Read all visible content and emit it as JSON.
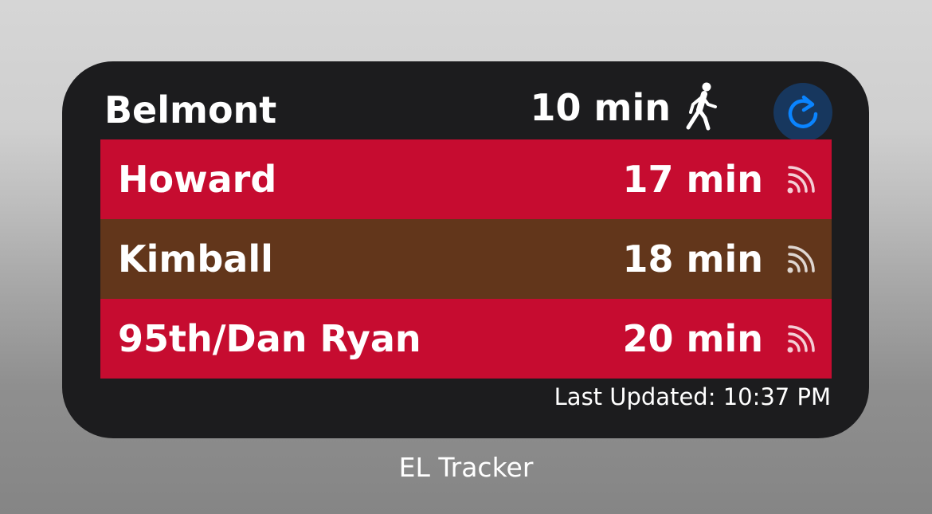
{
  "widget": {
    "station": "Belmont",
    "walk_time": "10 min",
    "walk_icon": "walking-person-icon",
    "refresh_icon": "refresh-icon",
    "refresh_color": "#0a84ff",
    "arrivals": [
      {
        "destination": "Howard",
        "eta": "17 min",
        "line_color": "#c60c30",
        "icon": "live-tracking-icon"
      },
      {
        "destination": "Kimball",
        "eta": "18 min",
        "line_color": "#62361b",
        "icon": "live-tracking-icon"
      },
      {
        "destination": "95th/Dan Ryan",
        "eta": "20 min",
        "line_color": "#c60c30",
        "icon": "live-tracking-icon"
      }
    ],
    "last_updated": "Last Updated: 10:37 PM"
  },
  "app": {
    "label": "EL Tracker"
  }
}
